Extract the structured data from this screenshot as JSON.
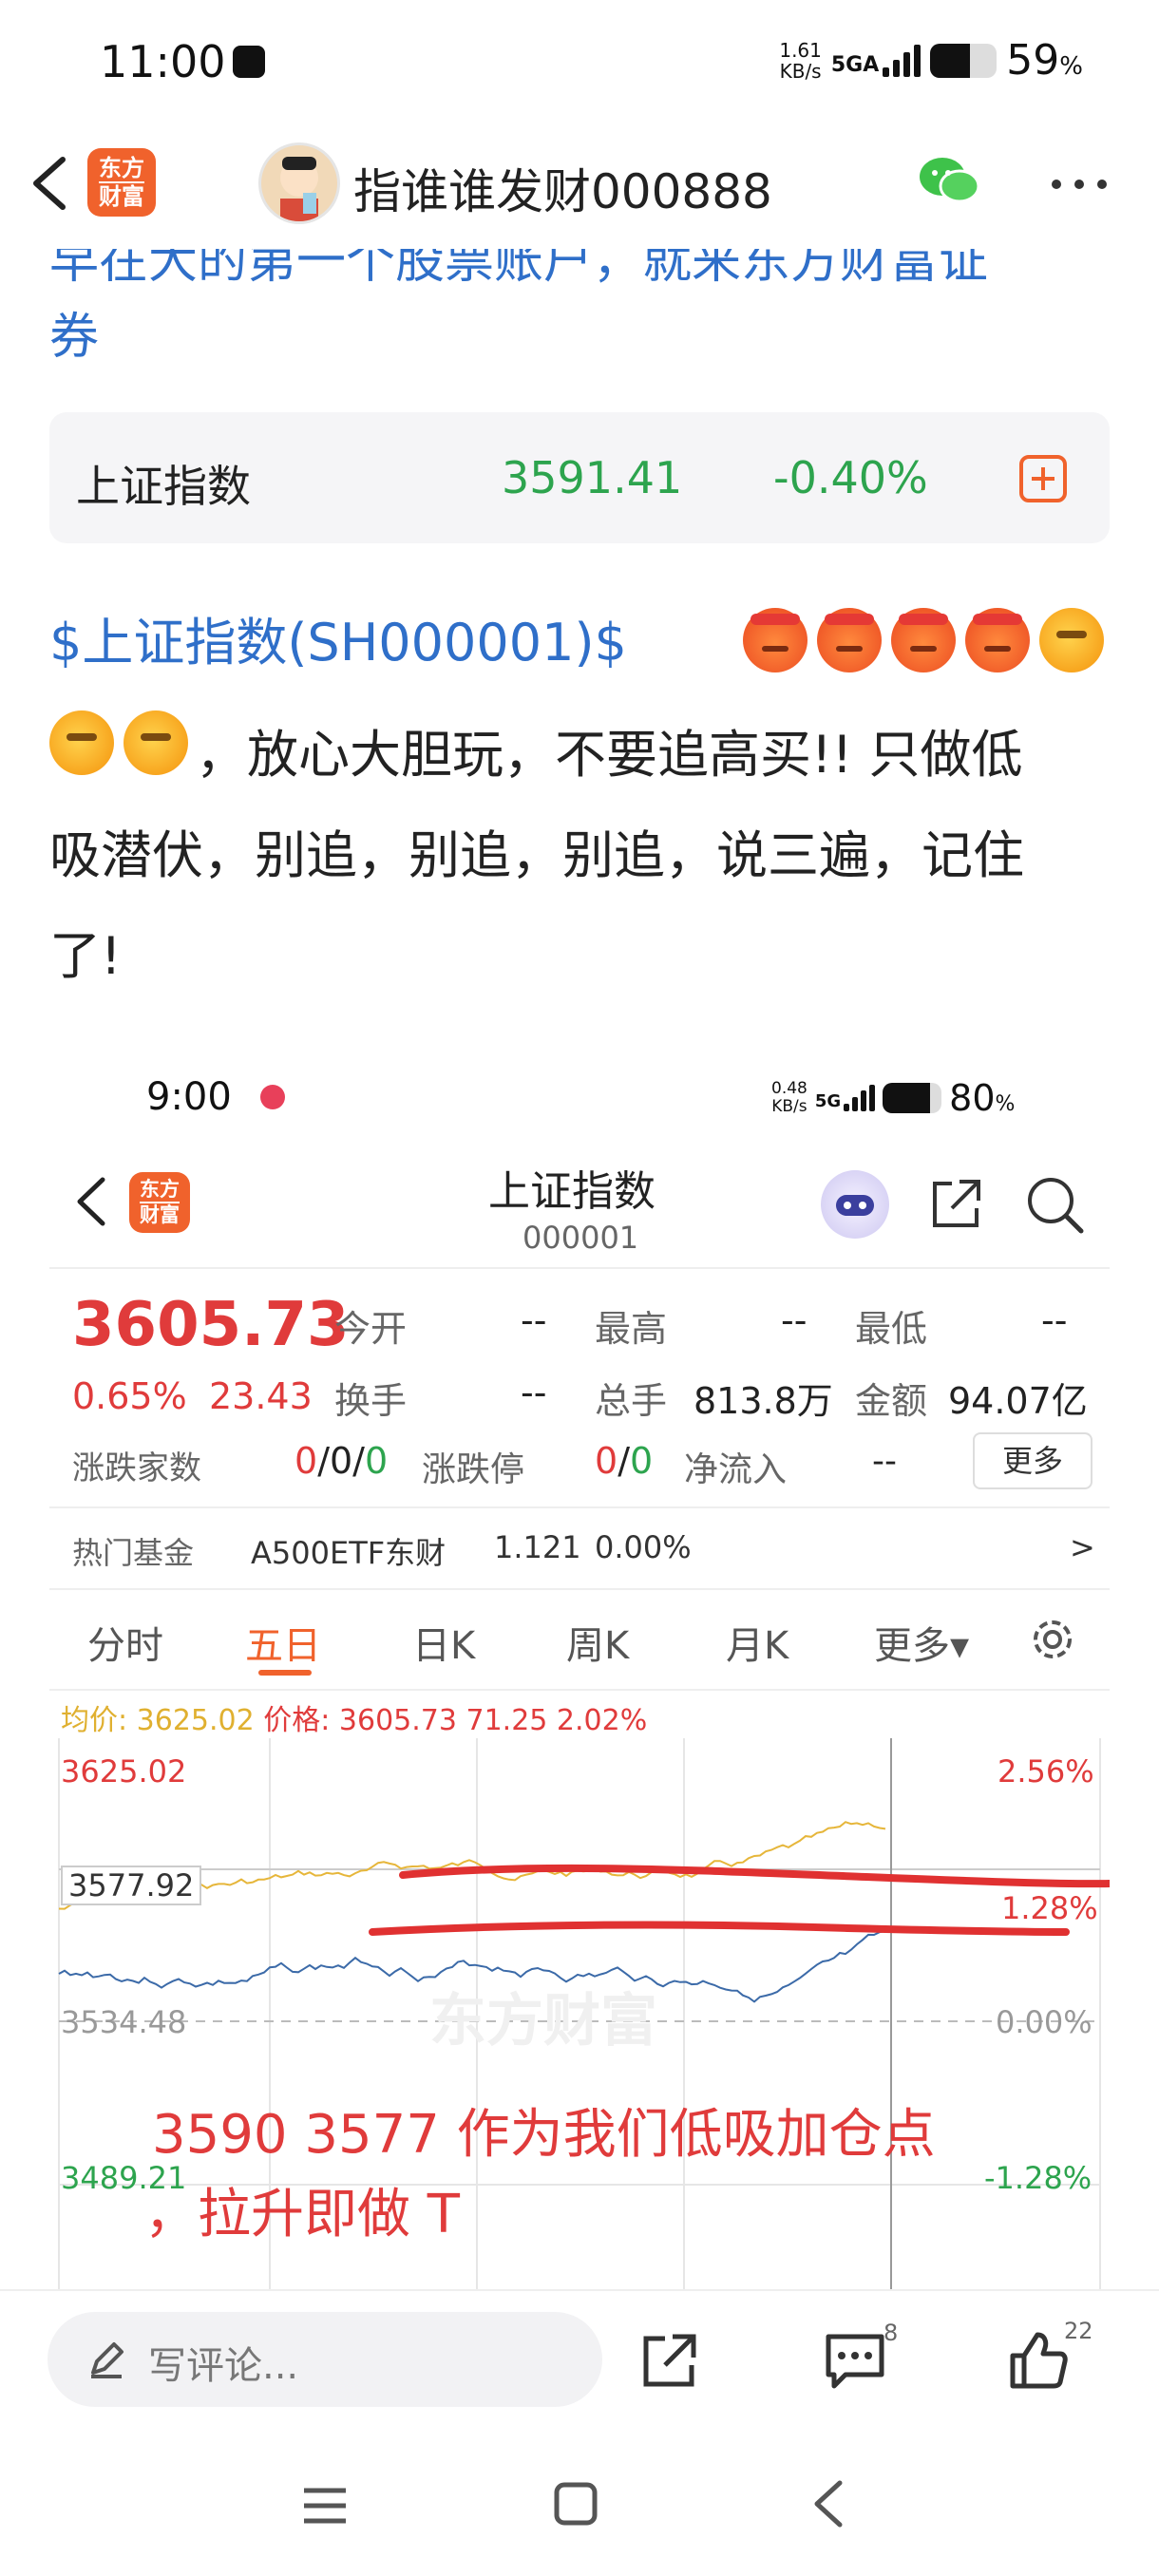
{
  "status_bar": {
    "time": "11:00",
    "speed_value": "1.61",
    "speed_unit": "KB/s",
    "network": "5GA",
    "battery": "59",
    "battery_unit": "%",
    "battery_level": 0.59
  },
  "nav": {
    "back_icon": "back-arrow-icon",
    "app_logo_line1": "东方",
    "app_logo_line2": "财富",
    "username": "指谁谁发财000888",
    "wechat_icon": "wechat-icon",
    "more_icon": "more-dots-icon"
  },
  "post": {
    "cut_text": "早在大的第一个股票账户，就来东方财富证",
    "cut_text2": "券",
    "index_card": {
      "name": "上证指数",
      "price": "3591.41",
      "change": "-0.40%",
      "add_icon": "add-square-icon"
    },
    "line1_link": "$上证指数(SH000001)$",
    "line2": "，放心大胆玩，不要追高买!! 只做低",
    "line3": "吸潜伏，别追，别追，别追，说三遍，记住",
    "line4": "了!"
  },
  "embedded": {
    "status_time": "9:00",
    "speed_value": "0.48",
    "speed_unit": "KB/s",
    "network": "5G",
    "battery": "80",
    "battery_unit": "%",
    "battery_level": 0.8,
    "logo_line1": "东方",
    "logo_line2": "财富",
    "title": "上证指数",
    "code": "000001",
    "price": "3605.73",
    "pct": "0.65%",
    "change": "23.43",
    "open_label": "今开",
    "open_value": "--",
    "high_label": "最高",
    "high_value": "--",
    "low_label": "最低",
    "low_value": "--",
    "turnover_label": "换手",
    "turnover_value": "--",
    "volume_label": "总手",
    "volume_value": "813.8万",
    "amount_label": "金额",
    "amount_value": "94.07亿",
    "breadth_label": "涨跌家数",
    "breadth_a": "0",
    "breadth_b": "/0/",
    "breadth_c": "0",
    "limit_label": "涨跌停",
    "limit_a": "0",
    "limit_b": "/",
    "limit_c": "0",
    "netflow_label": "净流入",
    "netflow_value": "--",
    "more_button": "更多",
    "fund_label": "热门基金",
    "fund_name": "A500ETF东财",
    "fund_price": "1.121",
    "fund_pct": "0.00%",
    "fund_arrow": ">",
    "tabs": [
      "分时",
      "五日",
      "日K",
      "周K",
      "月K",
      "更多▾"
    ],
    "active_tab": "五日",
    "legend_avg": "均价: 3625.02",
    "legend_price": "价格: 3605.73  71.25  2.02%",
    "y_left": [
      "3625.02",
      "3577.92",
      "3534.48",
      "3489.21"
    ],
    "y_right": [
      "2.56%",
      "1.28%",
      "0.00%",
      "-1.28%"
    ],
    "watermark": "东方财富",
    "annotation_line1": "3590 3577 作为我们低吸加仓点",
    "annotation_line2": "，拉升即做 T"
  },
  "bottom": {
    "comment_placeholder": "写评论...",
    "comment_count": "8",
    "like_count": "22"
  },
  "colors": {
    "red": "#e03b3b",
    "green": "#2da44e",
    "blue": "#2f6fc9",
    "orange": "#f0622c"
  }
}
